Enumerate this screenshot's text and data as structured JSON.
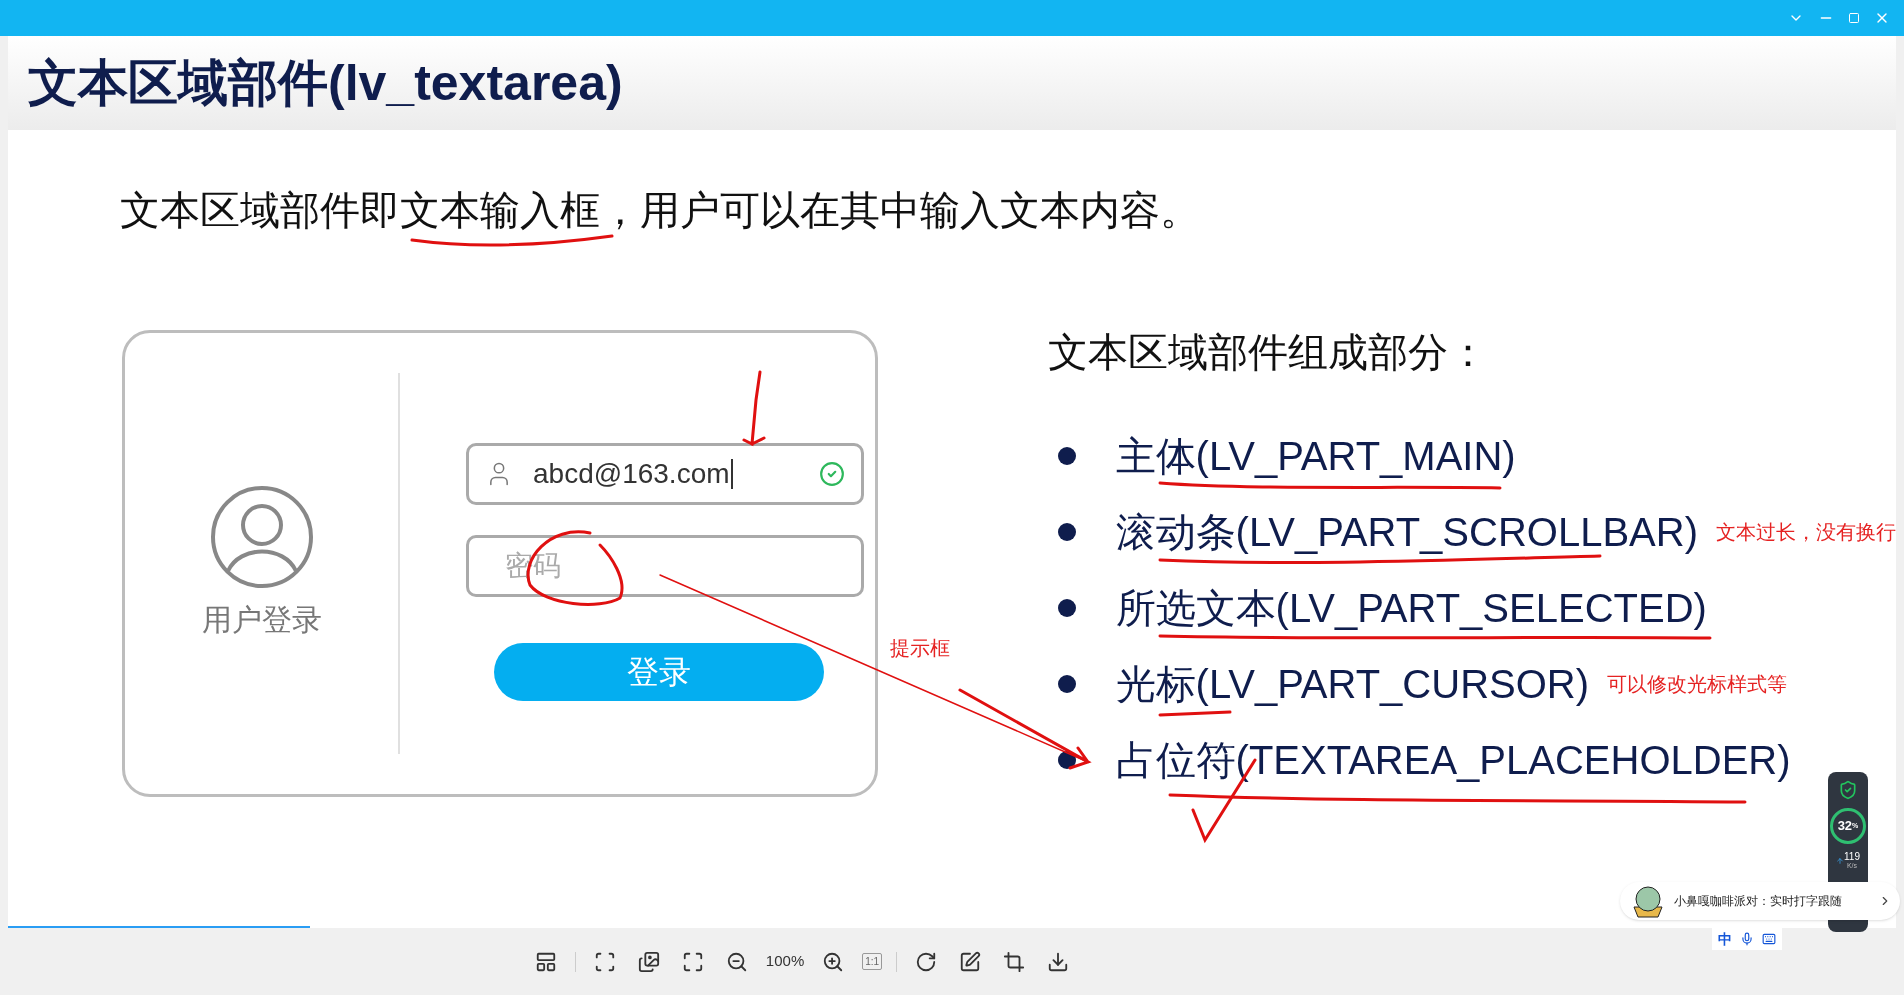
{
  "slide": {
    "title": "文本区域部件(lv_textarea)",
    "intro": "文本区域部件即文本输入框，用户可以在其中输入文本内容。",
    "login_card": {
      "caption": "用户登录",
      "email_field": {
        "value": "abcd@163.com",
        "valid": true
      },
      "password_field": {
        "placeholder": "密码"
      },
      "button": "登录"
    },
    "parts_heading": "文本区域部件组成部分：",
    "parts": [
      {
        "label": "主体(LV_PART_MAIN)"
      },
      {
        "label": "滚动条(LV_PART_SCROLLBAR)",
        "note": "文本过长，没有换行"
      },
      {
        "label": "所选文本(LV_PART_SELECTED)"
      },
      {
        "label": "光标(LV_PART_CURSOR)",
        "note": "可以修改光标样式等"
      },
      {
        "label": "占位符(TEXTAREA_PLACEHOLDER)"
      }
    ],
    "hint_note": "提示框"
  },
  "progress": {
    "level": 0.16
  },
  "viewer_toolbar": {
    "zoom": "100%",
    "actual_size": "1:1"
  },
  "perf_widget": {
    "cpu": "32",
    "cpu_unit": "%",
    "speed": "119",
    "speed_unit": "K/s"
  },
  "ime_popup": {
    "text": "小鼻嘎咖啡派对：实时打字跟随"
  },
  "ime_toolbar": {
    "mode": "中"
  }
}
